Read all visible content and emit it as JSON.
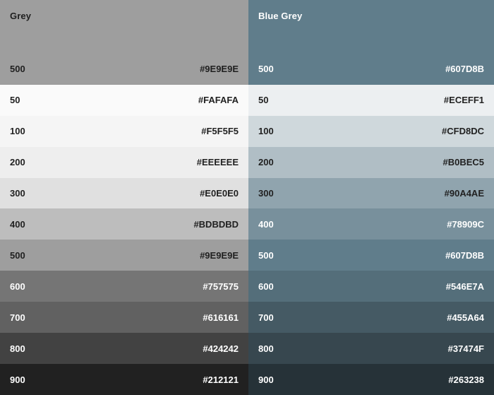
{
  "palettes": [
    {
      "name": "Grey",
      "primary": {
        "shade": "500",
        "hex": "#9E9E9E",
        "color": "#9e9e9e",
        "text_color": "#1f1f1f"
      },
      "shades": [
        {
          "shade": "50",
          "hex": "#FAFAFA",
          "color": "#fafafa",
          "text_color": "#212121"
        },
        {
          "shade": "100",
          "hex": "#F5F5F5",
          "color": "#f5f5f5",
          "text_color": "#212121"
        },
        {
          "shade": "200",
          "hex": "#EEEEEE",
          "color": "#eeeeee",
          "text_color": "#212121"
        },
        {
          "shade": "300",
          "hex": "#E0E0E0",
          "color": "#e0e0e0",
          "text_color": "#212121"
        },
        {
          "shade": "400",
          "hex": "#BDBDBD",
          "color": "#bdbdbd",
          "text_color": "#212121"
        },
        {
          "shade": "500",
          "hex": "#9E9E9E",
          "color": "#9e9e9e",
          "text_color": "#212121"
        },
        {
          "shade": "600",
          "hex": "#757575",
          "color": "#757575",
          "text_color": "#ffffff"
        },
        {
          "shade": "700",
          "hex": "#616161",
          "color": "#616161",
          "text_color": "#ffffff"
        },
        {
          "shade": "800",
          "hex": "#424242",
          "color": "#424242",
          "text_color": "#ffffff"
        },
        {
          "shade": "900",
          "hex": "#212121",
          "color": "#212121",
          "text_color": "#ffffff"
        }
      ]
    },
    {
      "name": "Blue Grey",
      "primary": {
        "shade": "500",
        "hex": "#607D8B",
        "color": "#607d8b",
        "text_color": "#ffffff"
      },
      "shades": [
        {
          "shade": "50",
          "hex": "#ECEFF1",
          "color": "#eceff1",
          "text_color": "#212121"
        },
        {
          "shade": "100",
          "hex": "#CFD8DC",
          "color": "#cfd8dc",
          "text_color": "#212121"
        },
        {
          "shade": "200",
          "hex": "#B0BEC5",
          "color": "#b0bec5",
          "text_color": "#212121"
        },
        {
          "shade": "300",
          "hex": "#90A4AE",
          "color": "#90a4ae",
          "text_color": "#212121"
        },
        {
          "shade": "400",
          "hex": "#78909C",
          "color": "#78909c",
          "text_color": "#ffffff"
        },
        {
          "shade": "500",
          "hex": "#607D8B",
          "color": "#607d8b",
          "text_color": "#ffffff"
        },
        {
          "shade": "600",
          "hex": "#546E7A",
          "color": "#546e7a",
          "text_color": "#ffffff"
        },
        {
          "shade": "700",
          "hex": "#455A64",
          "color": "#455a64",
          "text_color": "#ffffff"
        },
        {
          "shade": "800",
          "hex": "#37474F",
          "color": "#37474f",
          "text_color": "#ffffff"
        },
        {
          "shade": "900",
          "hex": "#263238",
          "color": "#263238",
          "text_color": "#ffffff"
        }
      ]
    }
  ]
}
